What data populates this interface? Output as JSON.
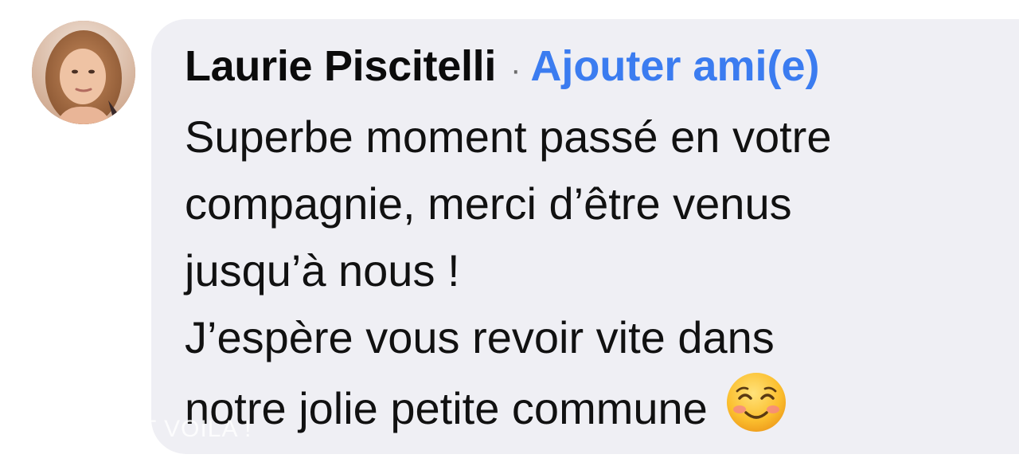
{
  "comment": {
    "author": "Laurie Piscitelli",
    "separator": "·",
    "add_friend_label": "Ajouter ami(e)",
    "lines": [
      "Superbe moment passé en votre",
      "compagnie, merci d’être venus",
      "jusqu’à nous !",
      "J’espère vous revoir vite dans",
      "notre jolie petite commune"
    ],
    "emoji": "smiling-face-with-smiling-eyes-icon"
  },
  "watermark": "T VOILA !",
  "colors": {
    "bubble": "#efeff4",
    "link": "#3b7cf0",
    "text": "#111111"
  }
}
